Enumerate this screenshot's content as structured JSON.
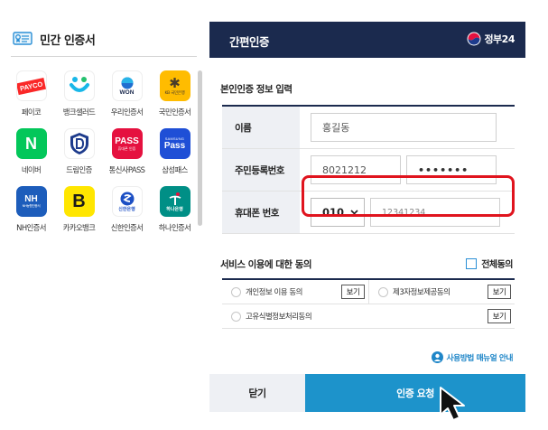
{
  "left_panel": {
    "title": "민간 인증서",
    "apps": [
      {
        "label": "페이코",
        "icon": "payco-icon",
        "logo_text": "PAYCO"
      },
      {
        "label": "뱅크샐러드",
        "icon": "banksalad-icon",
        "logo_text": ""
      },
      {
        "label": "우리인증서",
        "icon": "woori-bank-icon",
        "logo_text": "WON"
      },
      {
        "label": "국민인증서",
        "icon": "kb-bank-icon",
        "logo_text": "KB 국민은행"
      },
      {
        "label": "네이버",
        "icon": "naver-icon",
        "logo_text": "N"
      },
      {
        "label": "드림인증",
        "icon": "dream-cert-icon",
        "logo_text": ""
      },
      {
        "label": "통신사PASS",
        "icon": "pass-icon",
        "logo_text": "PASS",
        "logo_subtext": "휴대폰 인증"
      },
      {
        "label": "삼성패스",
        "icon": "samsung-pass-icon",
        "logo_text": "Pass",
        "logo_subtext": "SAMSUNG"
      },
      {
        "label": "NH인증서",
        "icon": "nh-bank-icon",
        "logo_text": "NH",
        "logo_subtext": "NH농협인증서"
      },
      {
        "label": "카카오뱅크",
        "icon": "kakaobank-icon",
        "logo_text": "B"
      },
      {
        "label": "신한인증서",
        "icon": "shinhan-bank-icon",
        "logo_text": "신한은행"
      },
      {
        "label": "하나인증서",
        "icon": "hana-bank-icon",
        "logo_text": "하나은행"
      }
    ]
  },
  "right_panel": {
    "header_title": "간편인증",
    "gov_label": "정부24",
    "section_identity": "본인인증 정보 입력",
    "fields": {
      "name_label": "이름",
      "name_value": "홍길동",
      "rrn_label": "주민등록번호",
      "rrn_front": "8021212",
      "rrn_back": "•••••••",
      "phone_label": "휴대폰 번호",
      "carrier_value": "010",
      "phone_value": "12341234"
    },
    "section_agree": "서비스 이용에 대한 동의",
    "agree_all_label": "전체동의",
    "agreements": [
      {
        "label": "개인정보 이용 동의",
        "view": "보기"
      },
      {
        "label": "제3자정보제공동의",
        "view": "보기"
      },
      {
        "label": "고유식별정보처리동의",
        "view": "보기"
      }
    ],
    "manual_link": "사용방법 매뉴얼 안내",
    "close_button": "닫기",
    "request_button": "인증 요청"
  },
  "colors": {
    "navy": "#1b2a4e",
    "accent_blue": "#1d93cb",
    "highlight_red": "#e0141e",
    "label_bg": "#eef0f4"
  }
}
